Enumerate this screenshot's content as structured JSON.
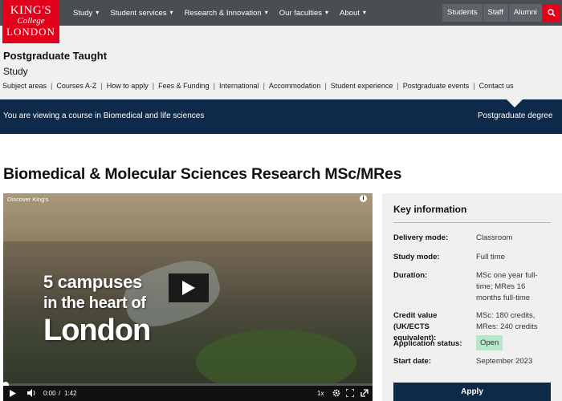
{
  "logo": {
    "line1": "KING'S",
    "line2": "College",
    "line3": "LONDON"
  },
  "nav": {
    "items": [
      {
        "label": "Study"
      },
      {
        "label": "Student services"
      },
      {
        "label": "Research & Innovation"
      },
      {
        "label": "Our faculties"
      },
      {
        "label": "About"
      }
    ],
    "chevron": "▾",
    "audiences": [
      {
        "label": "Students"
      },
      {
        "label": "Staff"
      },
      {
        "label": "Alumni"
      }
    ],
    "search_icon": "search-icon"
  },
  "subheader": {
    "title": "Postgraduate Taught",
    "subtitle": "Study",
    "links": [
      {
        "label": "Subject areas"
      },
      {
        "label": "Courses A-Z"
      },
      {
        "label": "How to apply"
      },
      {
        "label": "Fees & Funding"
      },
      {
        "label": "International"
      },
      {
        "label": "Accommodation"
      },
      {
        "label": "Student experience"
      },
      {
        "label": "Postgraduate events"
      },
      {
        "label": "Contact us"
      }
    ],
    "separator": "|"
  },
  "banner": {
    "text": "You are viewing a course in Biomedical and life sciences",
    "tag": "Postgraduate degree"
  },
  "course": {
    "title": "Biomedical & Molecular Sciences Research MSc/MRes"
  },
  "video": {
    "label": "Discover King's",
    "overlay_line1": "5 campuses",
    "overlay_line2": "in the heart of",
    "overlay_line3": "London",
    "current_time": "0:00",
    "time_separator": "/",
    "duration": "1:42",
    "speed": "1x",
    "progress": 0
  },
  "key_info": {
    "title": "Key information",
    "rows": [
      {
        "label": "Delivery mode:",
        "value": "Classroom"
      },
      {
        "label": "Study mode:",
        "value": "Full time"
      },
      {
        "label": "Duration:",
        "value": "MSc one year full-time; MRes 16 months full-time"
      },
      {
        "label": "Credit value (UK/ECTS equivalent):",
        "value": "MSc: 180 credits, MRes: 240 credits"
      },
      {
        "label": "Application status:",
        "value": "Open"
      },
      {
        "label": "Start date:",
        "value": "September 2023"
      }
    ],
    "apply_label": "Apply"
  },
  "colors": {
    "brand_red": "#e2001a",
    "nav_bg": "#4a4d52",
    "navy": "#0e2a4a",
    "panel_bg": "#f0f0f0",
    "open_badge": "#b7e6c9"
  }
}
